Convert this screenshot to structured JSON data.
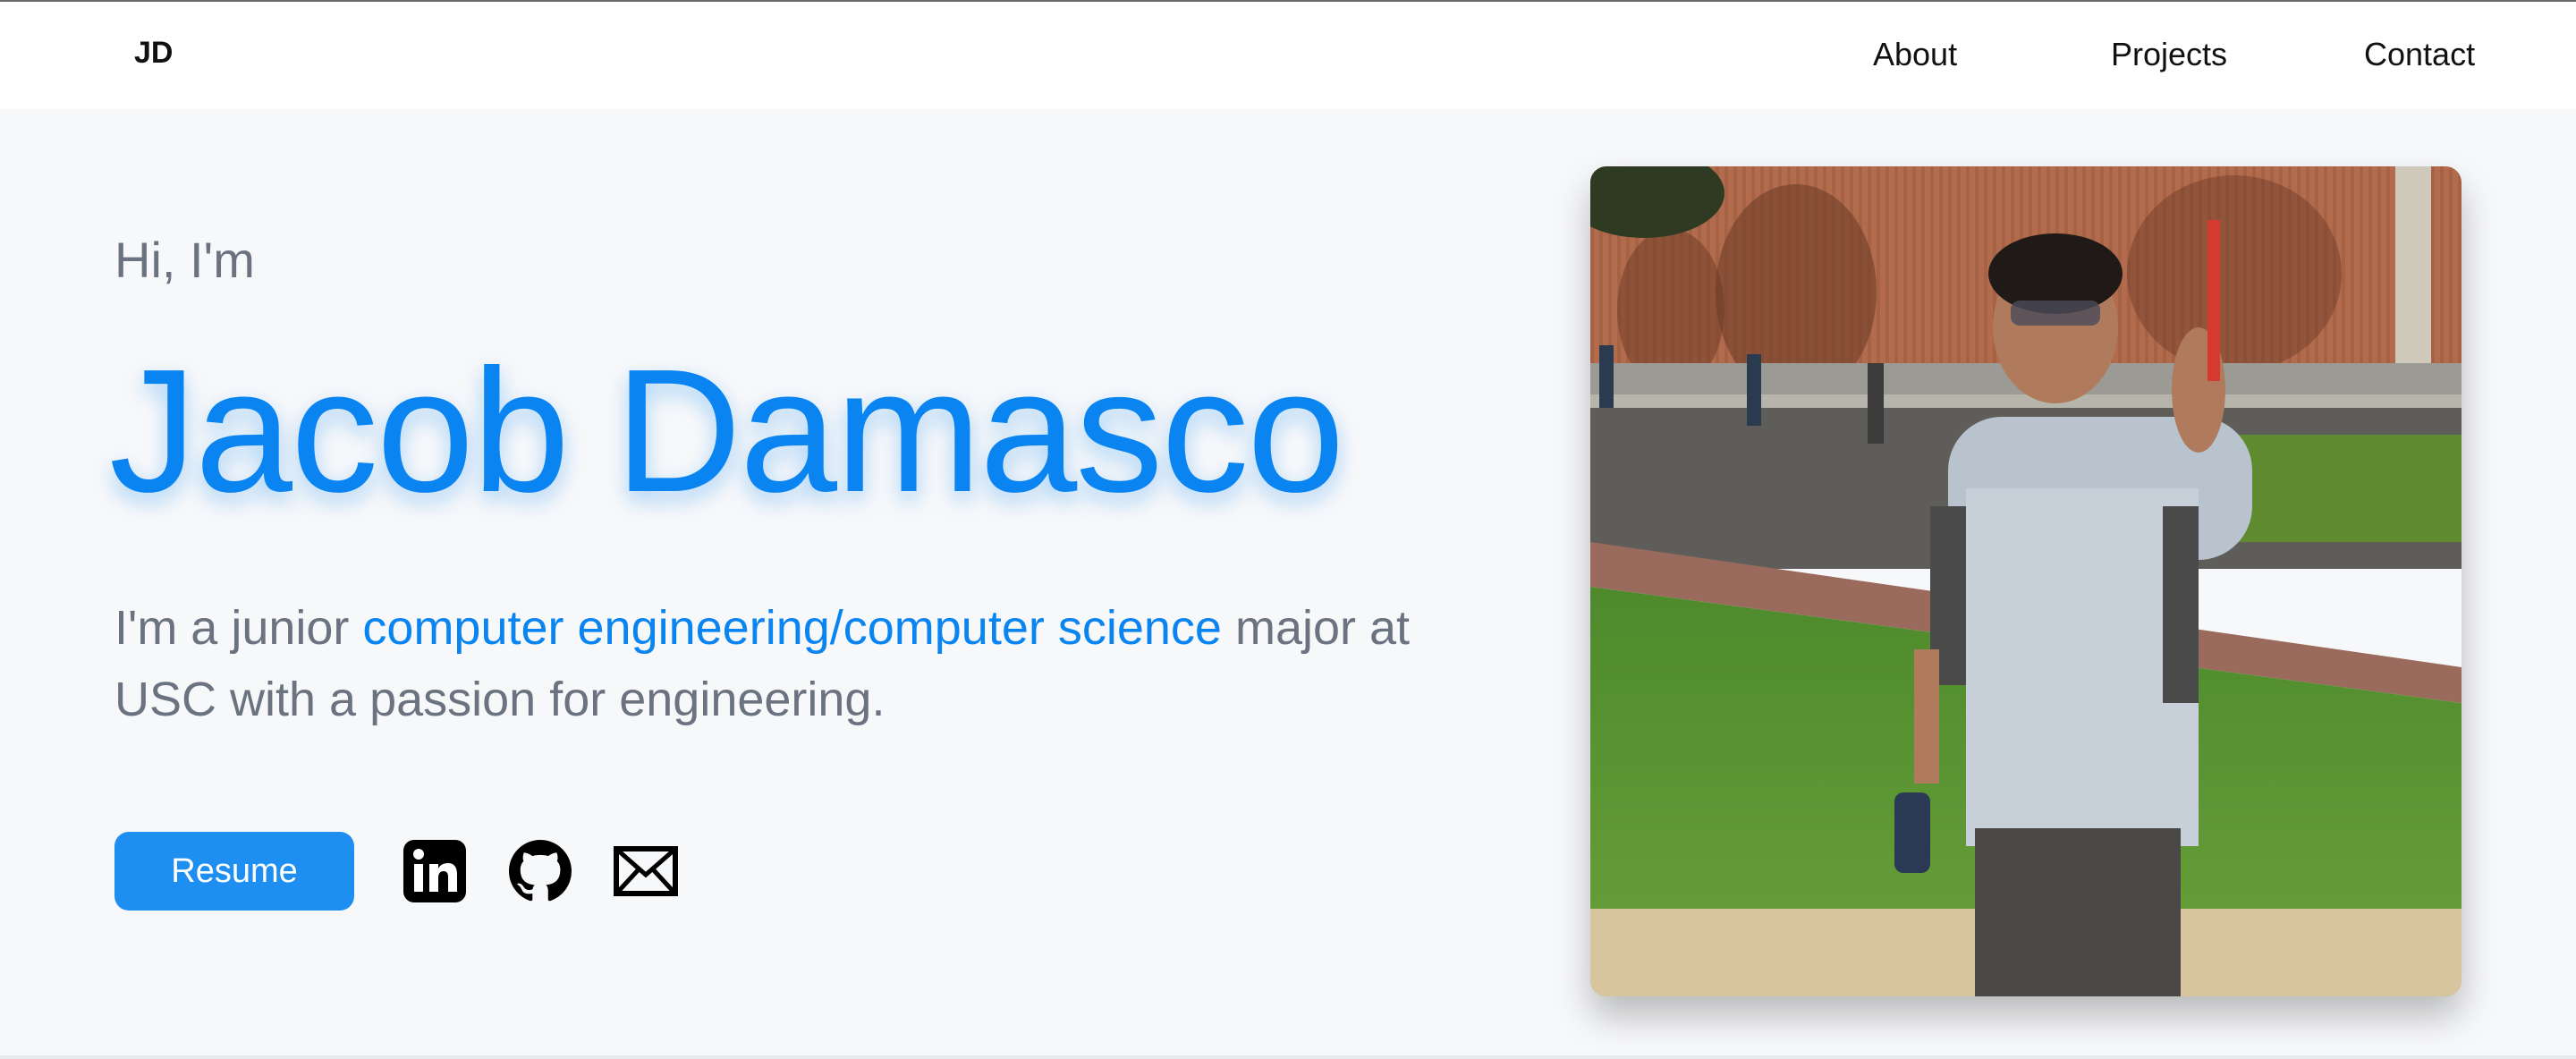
{
  "nav": {
    "logo": "JD",
    "links": [
      "About",
      "Projects",
      "Contact"
    ]
  },
  "hero": {
    "greeting": "Hi, I'm",
    "name": "Jacob Damasco",
    "bio_pre": "I'm a junior ",
    "bio_highlight": "computer engineering/computer science",
    "bio_post": " major at USC with a passion for engineering.",
    "resume_label": "Resume",
    "social_icons": [
      "linkedin-icon",
      "github-icon",
      "email-icon"
    ],
    "photo_alt": "Portrait photo on campus"
  },
  "colors": {
    "accent": "#0a84f0",
    "button": "#1e8ff0",
    "muted_text": "#6b7280",
    "background": "#f7f8fa"
  }
}
